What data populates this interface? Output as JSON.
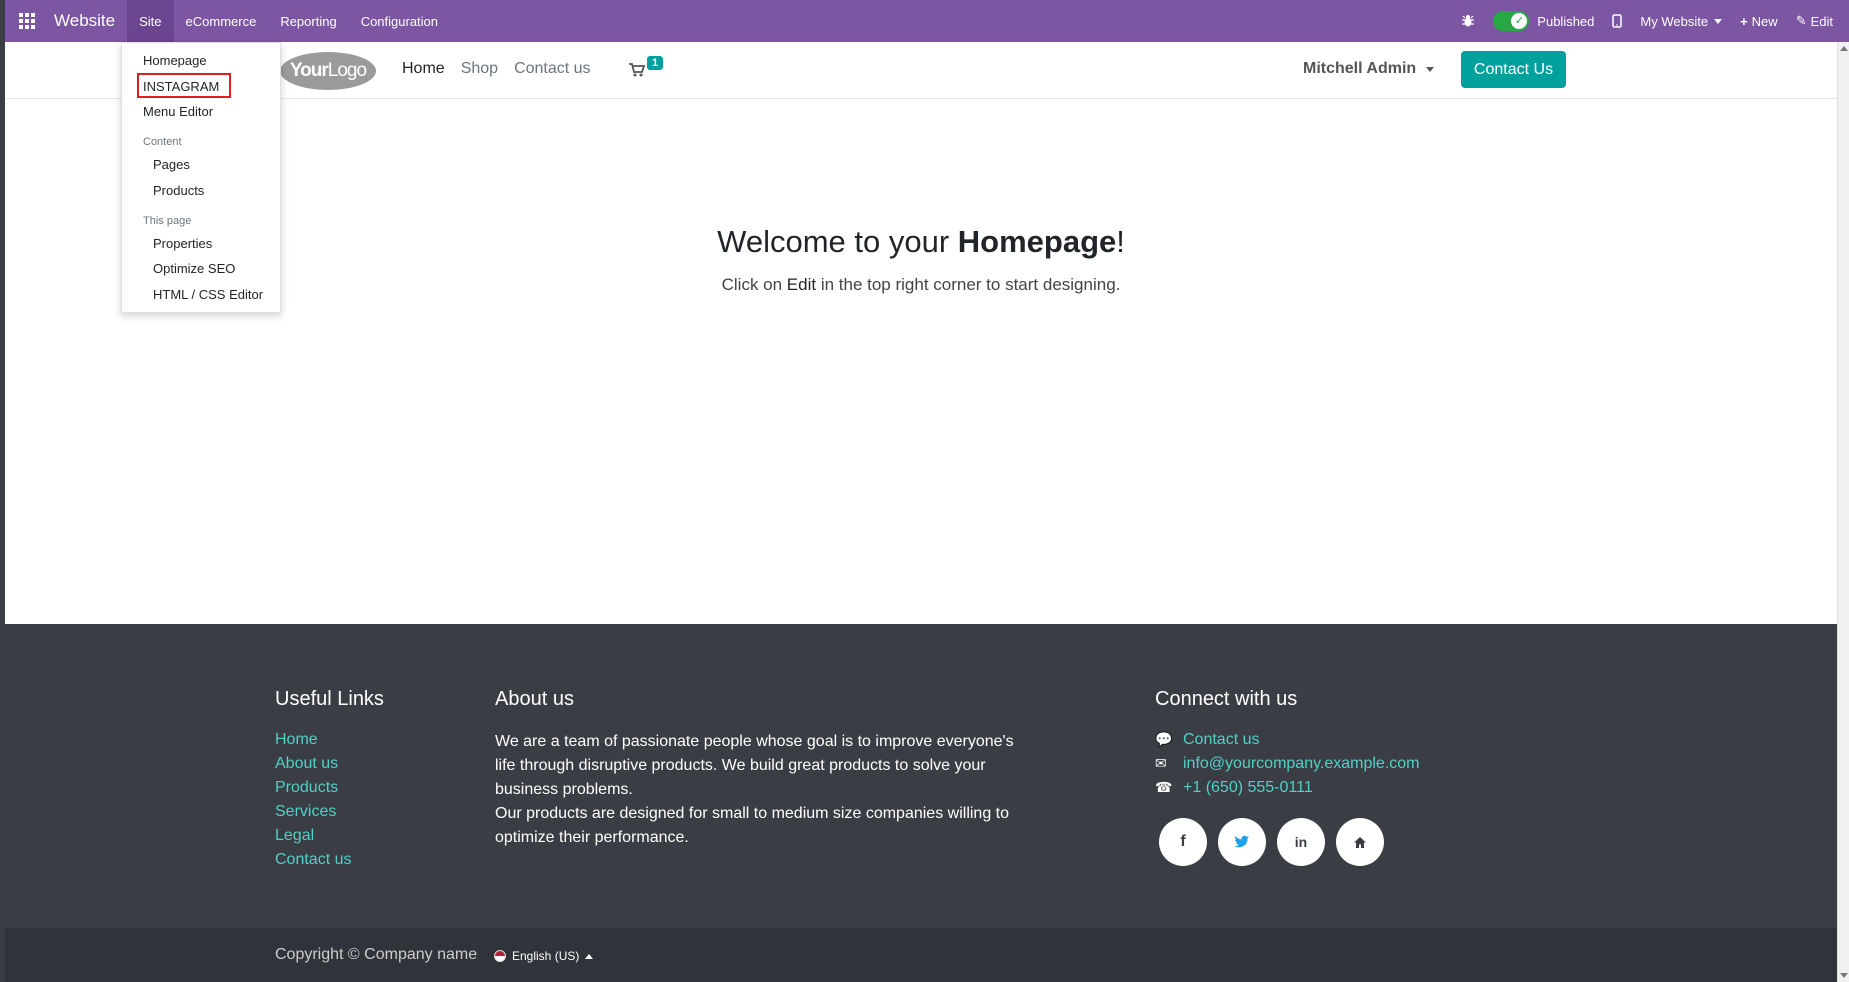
{
  "topbar": {
    "app_name": "Website",
    "menu": [
      "Site",
      "eCommerce",
      "Reporting",
      "Configuration"
    ],
    "published_label": "Published",
    "website_label": "My Website",
    "new_label": "New",
    "edit_label": "Edit"
  },
  "dropdown": {
    "homepage": "Homepage",
    "instagram": "INSTAGRAM",
    "menu_editor": "Menu Editor",
    "content_header": "Content",
    "pages": "Pages",
    "products": "Products",
    "this_page_header": "This page",
    "properties": "Properties",
    "optimize_seo": "Optimize SEO",
    "html_css_editor": "HTML / CSS Editor"
  },
  "header": {
    "logo_bold": "Your",
    "logo_thin": "Logo",
    "nav": [
      "Home",
      "Shop",
      "Contact us"
    ],
    "cart_count": "1",
    "user": "Mitchell Admin",
    "contact_button": "Contact Us"
  },
  "main": {
    "welcome_prefix": "Welcome to your ",
    "welcome_bold": "Homepage",
    "welcome_suffix": "!",
    "sub_prefix": "Click on ",
    "sub_edit": "Edit",
    "sub_suffix": " in the top right corner to start designing."
  },
  "footer": {
    "useful_links_title": "Useful Links",
    "useful_links": [
      "Home",
      "About us",
      "Products",
      "Services",
      "Legal",
      "Contact us"
    ],
    "about_title": "About us",
    "about_p1": "We are a team of passionate people whose goal is to improve everyone's life through disruptive products. We build great products to solve your business problems.",
    "about_p2": "Our products are designed for small to medium size companies willing to optimize their performance.",
    "connect_title": "Connect with us",
    "contact_us": "Contact us",
    "email": "info@yourcompany.example.com",
    "phone": "+1 (650) 555-0111",
    "social_icons": [
      "facebook-icon",
      "twitter-icon",
      "linkedin-icon",
      "home-icon"
    ]
  },
  "copyright": {
    "text": "Copyright © Company name",
    "language": "English (US)"
  },
  "colors": {
    "admin_bar": "#7c55a3",
    "accent": "#00a09d",
    "footer_bg": "#3a3d44",
    "link_teal": "#4fd1c5",
    "highlight": "#e02020"
  }
}
